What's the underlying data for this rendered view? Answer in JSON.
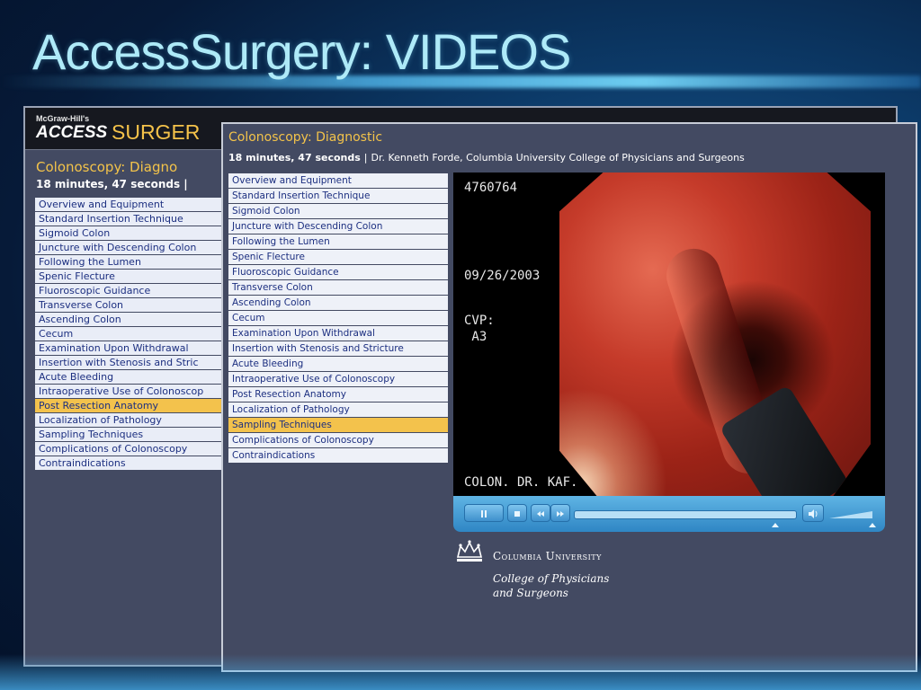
{
  "slide": {
    "title": "AccessSurgery: VIDEOS"
  },
  "back_window": {
    "brand_small": "McGraw-Hill's",
    "brand_access": "ACCESS",
    "brand_surgery": "SURGER",
    "title": "Colonoscopy: Diagno",
    "duration": "18 minutes, 47 seconds |",
    "items": [
      "Overview and Equipment",
      "Standard Insertion Technique",
      "Sigmoid Colon",
      "Juncture with Descending Colon",
      "Following the Lumen",
      "Spenic Flecture",
      "Fluoroscopic Guidance",
      "Transverse Colon",
      "Ascending Colon",
      "Cecum",
      "Examination Upon Withdrawal",
      "Insertion with Stenosis and Stric",
      "Acute Bleeding",
      "Intraoperative Use of Colonoscop",
      "Post Resection Anatomy",
      "Localization of Pathology",
      "Sampling Techniques",
      "Complications of Colonoscopy",
      "Contraindications"
    ],
    "active_index": 14
  },
  "front_window": {
    "title": "Colonoscopy: Diagnostic",
    "duration": "18 minutes, 47 seconds",
    "separator": "|",
    "author": "Dr. Kenneth Forde, Columbia University College of Physicians and Surgeons",
    "items": [
      "Overview and Equipment",
      "Standard Insertion Technique",
      "Sigmoid Colon",
      "Juncture with Descending Colon",
      "Following the Lumen",
      "Spenic Flecture",
      "Fluoroscopic Guidance",
      "Transverse Colon",
      "Ascending Colon",
      "Cecum",
      "Examination Upon Withdrawal",
      "Insertion with Stenosis and Stricture",
      "Acute Bleeding",
      "Intraoperative Use of Colonoscopy",
      "Post Resection Anatomy",
      "Localization of Pathology",
      "Sampling Techniques",
      "Complications of Colonoscopy",
      "Contraindications"
    ],
    "active_index": 16
  },
  "video": {
    "osd_id": "4760764",
    "osd_date": "09/26/2003",
    "osd_cvp": "CVP:\n A3",
    "osd_caption": "COLON. DR. KAF.",
    "playback_progress": 0.0,
    "volume_level": 0.75,
    "buttons": {
      "pause_icon": "pause-icon",
      "stop_icon": "stop-icon",
      "rewind_icon": "rewind-icon",
      "forward_icon": "fast-forward-icon",
      "volume_icon": "speaker-icon"
    }
  },
  "institution": {
    "name": "Columbia University",
    "college_line1": "College of Physicians",
    "college_line2": "and Surgeons"
  },
  "colors": {
    "accent_gold": "#f3c24c",
    "list_text": "#1c2f80",
    "panel_bg": "#434a62",
    "title_cyan": "#aeeaf8"
  }
}
